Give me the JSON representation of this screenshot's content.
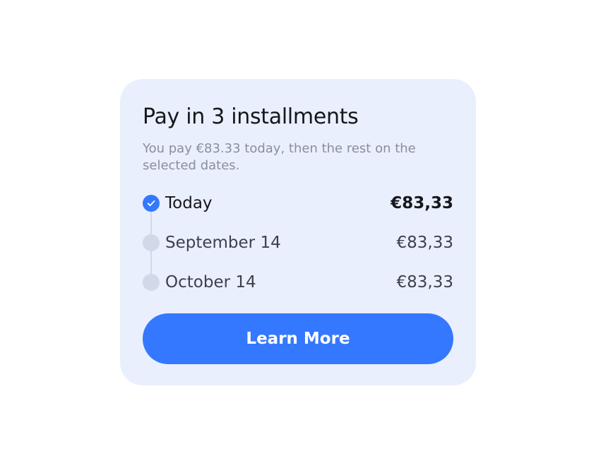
{
  "card": {
    "title": "Pay in 3 installments",
    "subtitle": "You pay €83.33 today, then the rest on the selected dates.",
    "installments": [
      {
        "label": "Today",
        "amount": "€83,33",
        "status": "paid"
      },
      {
        "label": "September 14",
        "amount": "€83,33",
        "status": "pending"
      },
      {
        "label": "October 14",
        "amount": "€83,33",
        "status": "pending"
      }
    ],
    "button_label": "Learn More"
  },
  "colors": {
    "card_background": "#eaeffd",
    "accent": "#3478ff",
    "pending_dot": "#d3d8e8",
    "title_text": "#15171c",
    "muted_text": "#8a8f9c"
  },
  "icons": {
    "paid_marker": "check-icon",
    "pending_marker": "circle-icon"
  }
}
